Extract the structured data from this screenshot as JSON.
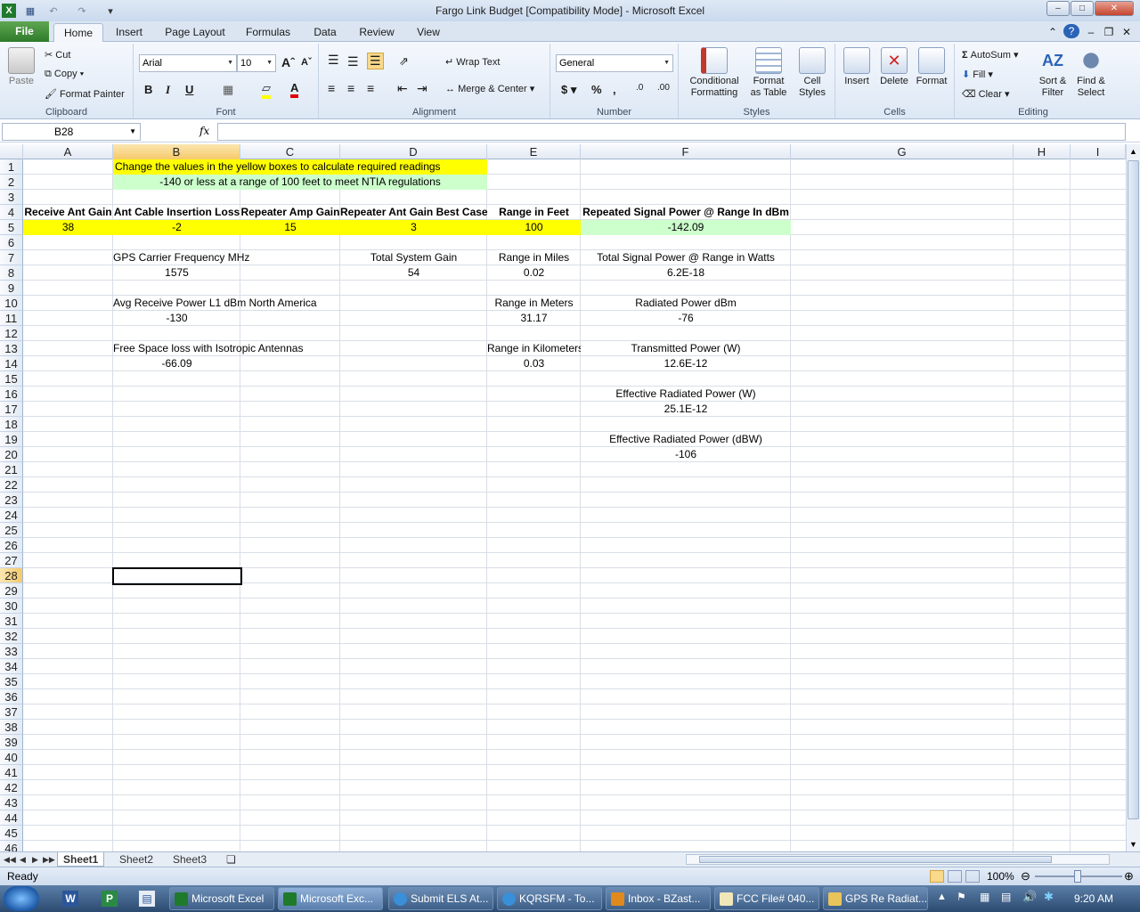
{
  "window": {
    "title": "Fargo Link Budget  [Compatibility Mode]  -  Microsoft Excel"
  },
  "tabs": [
    "File",
    "Home",
    "Insert",
    "Page Layout",
    "Formulas",
    "Data",
    "Review",
    "View"
  ],
  "ribbon": {
    "clipboard": {
      "label": "Clipboard",
      "paste": "Paste",
      "cut": "Cut",
      "copy": "Copy",
      "format_painter": "Format Painter"
    },
    "font": {
      "label": "Font",
      "name": "Arial",
      "size": "10"
    },
    "alignment": {
      "label": "Alignment",
      "wrap": "Wrap Text",
      "merge": "Merge & Center"
    },
    "number": {
      "label": "Number",
      "format": "General"
    },
    "styles": {
      "label": "Styles",
      "cond1": "Conditional",
      "cond2": "Formatting",
      "fmt1": "Format",
      "fmt2": "as Table",
      "cell1": "Cell",
      "cell2": "Styles"
    },
    "cells": {
      "label": "Cells",
      "insert": "Insert",
      "delete": "Delete",
      "format": "Format"
    },
    "editing": {
      "label": "Editing",
      "autosum": "AutoSum",
      "fill": "Fill",
      "clear": "Clear",
      "sort1": "Sort &",
      "sort2": "Filter",
      "find1": "Find &",
      "find2": "Select"
    }
  },
  "formula_bar": {
    "name_box": "B28",
    "fx": "fx",
    "value": ""
  },
  "columns": [
    "A",
    "B",
    "C",
    "D",
    "E",
    "F",
    "G",
    "H",
    "I"
  ],
  "rows": [
    "1",
    "2",
    "3",
    "4",
    "5",
    "6",
    "7",
    "8",
    "9",
    "10",
    "11",
    "12",
    "13",
    "14",
    "15",
    "16",
    "17",
    "18",
    "19",
    "20",
    "21",
    "22",
    "23",
    "24",
    "25",
    "26",
    "27",
    "28",
    "29",
    "30",
    "31",
    "32",
    "33",
    "34",
    "35",
    "36",
    "37",
    "38",
    "39",
    "40",
    "41",
    "42",
    "43",
    "44",
    "45",
    "46"
  ],
  "cells": {
    "r1": "Change the values in the yellow boxes to calculate required readings",
    "r2": "-140 or less at a range of 100 feet to meet NTIA regulations",
    "a4": "Receive Ant Gain",
    "b4": "Ant Cable Insertion Loss",
    "c4": "Repeater Amp Gain",
    "d4": "Repeater Ant Gain Best Case",
    "e4": "Range in Feet",
    "f4": "Repeated Signal Power  @ Range  In dBm",
    "a5": "38",
    "b5": "-2",
    "c5": "15",
    "d5": "3",
    "e5": "100",
    "f5": "-142.09",
    "b7": "GPS Carrier Frequency MHz",
    "d7": "Total System Gain",
    "e7": "Range in Miles",
    "f7": "Total Signal Power @ Range in Watts",
    "b8": "1575",
    "d8": "54",
    "e8": "0.02",
    "f8": "6.2E-18",
    "b10": "Avg Receive Power L1 dBm North America",
    "e10": "Range in Meters",
    "f10": "Radiated Power dBm",
    "b11": "-130",
    "e11": "31.17",
    "f11": "-76",
    "b13": "Free Space loss with Isotropic Antennas",
    "e13": "Range in Kilometers",
    "f13": "Transmitted Power (W)",
    "b14": "-66.09",
    "e14": "0.03",
    "f14": "12.6E-12",
    "f16": "Effective Radiated Power (W)",
    "f17": "25.1E-12",
    "f19": "Effective Radiated Power (dBW)",
    "f20": "-106"
  },
  "sheets": [
    "Sheet1",
    "Sheet2",
    "Sheet3"
  ],
  "status": {
    "ready": "Ready",
    "zoom": "100%"
  },
  "taskbar": {
    "items": [
      "Microsoft Excel",
      "Microsoft Exc...",
      "Submit ELS At...",
      "KQRSFM - To...",
      "Inbox - BZast...",
      "FCC File# 040...",
      "GPS Re Radiat..."
    ],
    "clock": "9:20 AM"
  },
  "colors": {
    "yellow": "#ffff00",
    "green": "#ccffcc",
    "accent": "#2e7b2a"
  }
}
